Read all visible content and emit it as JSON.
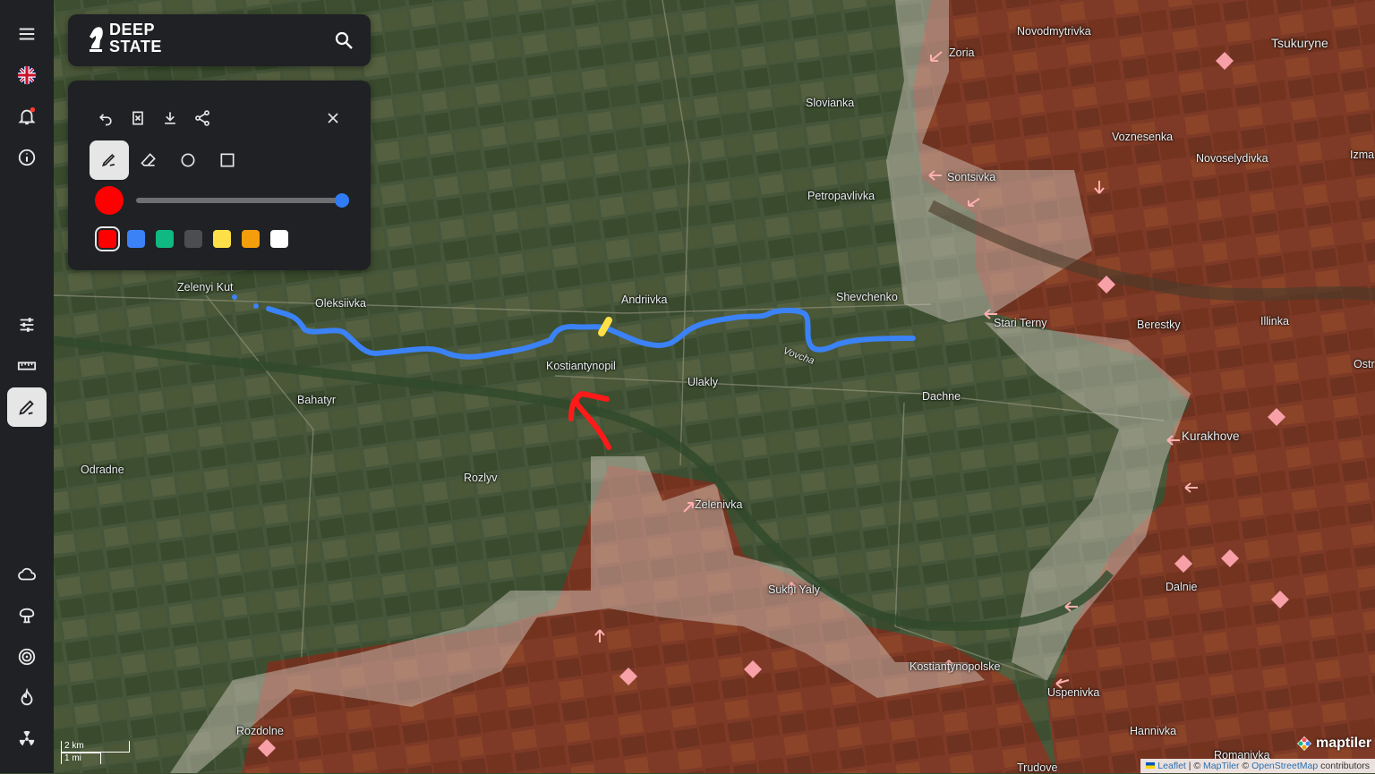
{
  "app": {
    "title_line1": "DEEP",
    "title_line2": "STATE"
  },
  "sidebar": {
    "items": [
      {
        "name": "menu-icon"
      },
      {
        "name": "uk-flag-icon"
      },
      {
        "name": "notification-bell-icon"
      },
      {
        "name": "info-icon"
      },
      {
        "name": "filters-icon"
      },
      {
        "name": "ruler-icon"
      },
      {
        "name": "draw-tool-icon",
        "active": true
      },
      {
        "name": "weather-cloud-icon"
      },
      {
        "name": "explosion-icon"
      },
      {
        "name": "target-icon"
      },
      {
        "name": "fire-icon"
      },
      {
        "name": "radiation-icon"
      }
    ]
  },
  "draw_panel": {
    "tools": [
      "undo-icon",
      "clear-icon",
      "download-icon",
      "share-icon",
      "close-icon"
    ],
    "modes": [
      "pen-icon",
      "eraser-icon",
      "circle-icon",
      "rectangle-icon"
    ],
    "active_mode": "pen",
    "brush_size_fraction": 1.0,
    "selected_color": "#ff0000",
    "palette": [
      "#ff0000",
      "#3b82f6",
      "#10b981",
      "#4b4d50",
      "#fde047",
      "#f59e0b",
      "#ffffff"
    ]
  },
  "map": {
    "labels": [
      "Novodmytrivka",
      "Tsukuryne",
      "Zoria",
      "Slovianka",
      "Voznesenka",
      "Novoselydivka",
      "Izma",
      "Sontsivka",
      "Petropavlivka",
      "Zelenyi Kut",
      "Oleksiivka",
      "Andriivka",
      "Shevchenko",
      "Stari Terny",
      "Berestky",
      "Illinka",
      "Ostr",
      "Kostiantynopil",
      "Ulakly",
      "Vovcha",
      "Dachne",
      "Bahatyr",
      "Kurakhove",
      "Odradne",
      "Rozlyv",
      "Zelenivka",
      "Dalnie",
      "Sukhi Yaly",
      "Kostiantynopolske",
      "Uspenivka",
      "Rozdolne",
      "Hannivka",
      "Romanivka",
      "Trudove"
    ],
    "scale_km": "2 km",
    "scale_mi": "1 mi",
    "attribution_leaflet": "Leaflet",
    "attribution_sep1": " | © ",
    "attribution_maptiler": "MapTiler",
    "attribution_sep2": " © ",
    "attribution_osm": "OpenStreetMap",
    "attribution_tail": " contributors",
    "provider_logo": "maptiler",
    "colors": {
      "occupied": "#8a2b1c",
      "contested": "#d8d0c8",
      "blue_line": "#3b82f6",
      "red_arrow": "#ff1a1a",
      "yellow_mark": "#fde047"
    }
  }
}
